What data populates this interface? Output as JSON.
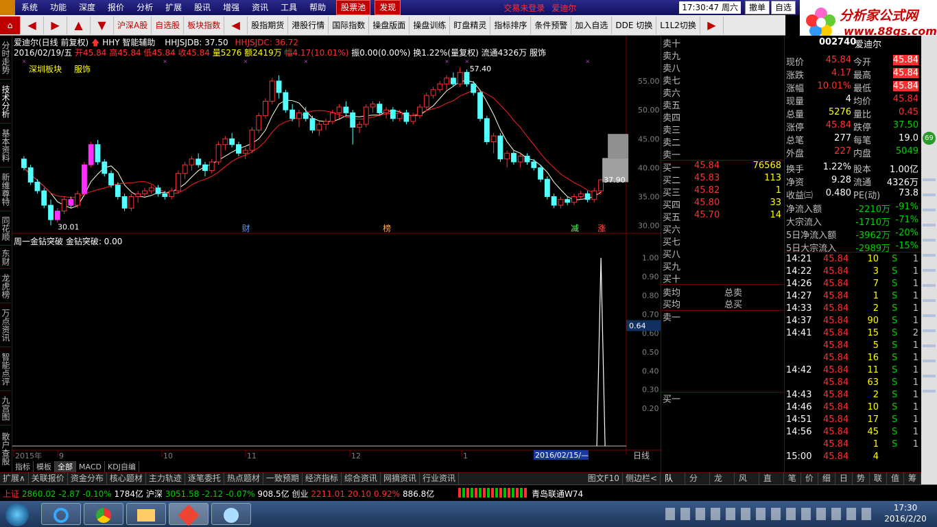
{
  "menu": [
    "系统",
    "功能",
    "深度",
    "报价",
    "分析",
    "扩展",
    "股讯",
    "增强",
    "资讯",
    "工具",
    "帮助"
  ],
  "menu_red": [
    "股票池",
    "发现"
  ],
  "login_status": "交易未登录",
  "stock_name_title": "爱迪尔",
  "clock": "17:30:47 周六",
  "top_buttons": [
    "撤单",
    "自选"
  ],
  "logo_text": "分析家公式网",
  "logo_url": "www.88gs.com",
  "toolbar": [
    "沪深A股",
    "自选股",
    "板块指数",
    "股指期货",
    "港股行情",
    "国际指数",
    "操盘版面",
    "操盘训练",
    "盯盘精灵",
    "指标排序",
    "条件预警",
    "加入自选",
    "DDE 切换",
    "L1L2切换"
  ],
  "left_tabs": [
    "分时走势",
    "技术分析",
    "基本资料",
    "新维尊特",
    "同花顺",
    "东财",
    "龙虎榜",
    "万点资讯",
    "智能点评",
    "九宫图",
    "散户查股"
  ],
  "chart": {
    "title": "爱迪尔(日线 前复权)",
    "indicator": "HHY 智能辅助",
    "hhjsjdb": "HHJSJDB: 37.50",
    "hhjsjdc": "HHJSJDC: 36.72",
    "date_line": "2016/02/19/五",
    "open": "开45.84",
    "high": "高45.84",
    "low": "低45.84",
    "close": "收45.84",
    "volume": "量5276",
    "amount": "额2419万",
    "change": "幅4.17(10.01%)",
    "amp": "振0.00(0.00%)",
    "turnover": "换1.22%(量复权)",
    "float": "流通4326万",
    "sector": "服饰",
    "region": "深圳板块",
    "sector2": "服饰",
    "high_label": "57.40",
    "low_label": "30.01",
    "last_label": "37.90",
    "markers": [
      "财",
      "榜",
      "减",
      "涨"
    ],
    "price_axis": [
      "55.00",
      "50.00",
      "45.00",
      "40.00",
      "35.00",
      "30.00"
    ],
    "sub_title": "周一金钻突破  金钻突破: 0.00",
    "sub_axis": [
      "1.00",
      "0.90",
      "0.80",
      "0.70",
      "0.60",
      "0.50",
      "0.40",
      "0.30",
      "0.20"
    ],
    "sub_current": "0.64",
    "time_axis": [
      "2015年",
      "9",
      "10",
      "11",
      "12",
      "1"
    ],
    "time_current": "2016/02/15/—",
    "period": "日线"
  },
  "chart_data": {
    "type": "candlestick",
    "ohlc": [
      [
        41.5,
        42.0,
        39.5,
        40.0
      ],
      [
        40.0,
        40.5,
        37.0,
        37.5
      ],
      [
        37.5,
        38.0,
        35.5,
        36.0
      ],
      [
        36.0,
        36.5,
        33.0,
        33.5
      ],
      [
        33.5,
        34.5,
        30.01,
        31.0
      ],
      [
        31.0,
        33.0,
        30.5,
        32.5
      ],
      [
        32.5,
        35.0,
        32.0,
        34.5
      ],
      [
        34.5,
        35.0,
        33.0,
        33.5
      ],
      [
        33.5,
        36.0,
        33.0,
        35.5
      ],
      [
        35.5,
        41.0,
        35.0,
        40.5
      ],
      [
        40.5,
        44.5,
        40.0,
        44.0
      ],
      [
        44.0,
        44.8,
        40.5,
        41.0
      ],
      [
        41.0,
        41.5,
        38.5,
        39.0
      ],
      [
        39.0,
        39.5,
        36.5,
        37.0
      ],
      [
        37.0,
        37.5,
        34.5,
        35.0
      ],
      [
        35.0,
        35.5,
        32.5,
        33.0
      ],
      [
        33.0,
        35.5,
        32.5,
        35.0
      ],
      [
        35.0,
        36.0,
        34.0,
        35.5
      ],
      [
        35.5,
        36.5,
        35.0,
        36.0
      ],
      [
        36.0,
        37.0,
        35.5,
        36.5
      ],
      [
        36.5,
        37.0,
        35.0,
        35.5
      ],
      [
        35.5,
        36.0,
        34.5,
        35.0
      ],
      [
        35.0,
        36.5,
        34.5,
        36.0
      ],
      [
        36.0,
        39.5,
        35.5,
        39.0
      ],
      [
        39.0,
        41.0,
        38.0,
        40.5
      ],
      [
        40.5,
        42.0,
        39.5,
        41.5
      ],
      [
        41.5,
        42.5,
        40.0,
        40.5
      ],
      [
        40.5,
        41.0,
        38.5,
        39.5
      ],
      [
        39.5,
        41.5,
        39.0,
        41.0
      ],
      [
        41.0,
        44.5,
        40.5,
        44.0
      ],
      [
        44.0,
        45.5,
        43.0,
        45.0
      ],
      [
        45.0,
        46.0,
        43.5,
        44.0
      ],
      [
        44.0,
        44.5,
        42.0,
        42.5
      ],
      [
        42.5,
        43.5,
        41.5,
        43.0
      ],
      [
        43.0,
        47.0,
        42.5,
        46.5
      ],
      [
        46.5,
        49.5,
        46.0,
        49.0
      ],
      [
        49.0,
        52.0,
        48.5,
        51.5
      ],
      [
        51.5,
        55.5,
        51.0,
        55.0
      ],
      [
        55.0,
        56.0,
        52.0,
        53.0
      ],
      [
        53.0,
        53.5,
        49.5,
        50.0
      ],
      [
        50.0,
        51.0,
        48.0,
        48.5
      ],
      [
        48.5,
        50.0,
        47.0,
        49.5
      ],
      [
        49.5,
        50.5,
        48.0,
        48.5
      ],
      [
        48.5,
        49.0,
        46.0,
        46.5
      ],
      [
        46.5,
        48.0,
        45.5,
        47.5
      ],
      [
        47.5,
        48.5,
        46.5,
        48.0
      ],
      [
        48.0,
        50.0,
        47.5,
        49.5
      ],
      [
        49.5,
        51.0,
        48.5,
        50.5
      ],
      [
        50.5,
        51.5,
        49.0,
        49.5
      ],
      [
        49.5,
        50.0,
        44.0,
        47.0
      ],
      [
        47.0,
        48.0,
        46.0,
        47.5
      ],
      [
        47.5,
        51.0,
        47.0,
        50.5
      ],
      [
        50.5,
        51.5,
        49.5,
        51.0
      ],
      [
        51.0,
        51.5,
        49.0,
        49.5
      ],
      [
        49.5,
        50.5,
        48.5,
        50.0
      ],
      [
        50.0,
        50.5,
        48.0,
        48.5
      ],
      [
        48.5,
        50.0,
        48.0,
        49.5
      ],
      [
        49.5,
        50.0,
        47.5,
        48.0
      ],
      [
        48.0,
        49.5,
        47.5,
        49.0
      ],
      [
        49.0,
        51.0,
        48.5,
        50.5
      ],
      [
        50.5,
        53.0,
        50.0,
        52.5
      ],
      [
        52.5,
        54.0,
        52.0,
        53.5
      ],
      [
        53.5,
        55.0,
        53.0,
        54.5
      ],
      [
        54.5,
        56.0,
        53.5,
        55.5
      ],
      [
        55.5,
        56.5,
        54.0,
        54.5
      ],
      [
        54.5,
        57.4,
        54.0,
        56.5
      ],
      [
        56.5,
        57.0,
        54.0,
        54.5
      ],
      [
        54.5,
        55.0,
        52.5,
        53.0
      ],
      [
        53.0,
        53.5,
        48.0,
        48.5
      ],
      [
        48.5,
        49.0,
        44.0,
        44.5
      ],
      [
        44.5,
        46.0,
        42.5,
        45.5
      ],
      [
        45.5,
        46.0,
        41.0,
        41.5
      ],
      [
        41.5,
        43.0,
        40.0,
        42.5
      ],
      [
        42.5,
        43.0,
        40.5,
        41.0
      ],
      [
        41.0,
        42.5,
        40.0,
        42.0
      ],
      [
        42.0,
        42.5,
        40.5,
        41.0
      ],
      [
        41.0,
        41.5,
        39.5,
        40.0
      ],
      [
        40.0,
        40.5,
        37.5,
        38.0
      ],
      [
        38.0,
        38.5,
        34.5,
        35.0
      ],
      [
        35.0,
        35.5,
        33.0,
        33.5
      ],
      [
        33.5,
        35.0,
        33.0,
        34.5
      ],
      [
        34.5,
        35.0,
        33.5,
        34.0
      ],
      [
        34.0,
        35.5,
        33.5,
        35.0
      ],
      [
        35.0,
        36.0,
        34.5,
        35.5
      ],
      [
        35.5,
        36.0,
        34.0,
        34.5
      ],
      [
        34.5,
        36.5,
        34.0,
        36.0
      ],
      [
        36.0,
        38.0,
        35.5,
        37.9
      ]
    ],
    "limit_up_blocks": [
      [
        41.67,
        45.84
      ]
    ],
    "ylim": [
      29,
      57.5
    ],
    "sub_series": {
      "name": "金钻突破",
      "peak_index": 86,
      "value": 1.0,
      "ylim": [
        0,
        1.05
      ]
    }
  },
  "quote": {
    "code": "002740",
    "name": "爱迪尔",
    "fields": [
      [
        "现价",
        "45.84",
        "今开",
        "45.84"
      ],
      [
        "涨跌",
        "4.17",
        "最高",
        "45.84"
      ],
      [
        "涨幅",
        "10.01%",
        "最低",
        "45.84"
      ],
      [
        "现量",
        "4",
        "均价",
        "45.84"
      ],
      [
        "总量",
        "5276",
        "量比",
        "0.45"
      ],
      [
        "涨停",
        "45.84",
        "跌停",
        "37.50"
      ],
      [
        "总笔",
        "277",
        "每笔",
        "19.0"
      ],
      [
        "外盘",
        "227",
        "内盘",
        "5049"
      ],
      [
        "换手",
        "1.22%",
        "股本",
        "1.00亿"
      ],
      [
        "净资",
        "9.28",
        "流通",
        "4326万"
      ],
      [
        "收益㈢",
        "0.480",
        "PE(动)",
        "73.8"
      ]
    ],
    "flows": [
      [
        "净流入额",
        "-2210万",
        "-91%"
      ],
      [
        "大宗流入",
        "-1710万",
        "-71%"
      ],
      [
        "5日净流入额",
        "-3962万",
        "-20%"
      ],
      [
        "5日大宗流入",
        "-2989万",
        "-15%"
      ]
    ]
  },
  "orderbook": {
    "sell": [
      "卖十",
      "卖九",
      "卖八",
      "卖七",
      "卖六",
      "卖五",
      "卖四",
      "卖三",
      "卖二",
      "卖一"
    ],
    "buy": [
      [
        "买一",
        "45.84",
        "76568"
      ],
      [
        "买二",
        "45.83",
        "113"
      ],
      [
        "买三",
        "45.82",
        "1"
      ],
      [
        "买四",
        "45.80",
        "33"
      ],
      [
        "买五",
        "45.70",
        "14"
      ],
      [
        "买六",
        "",
        ""
      ],
      [
        "买七",
        "",
        ""
      ],
      [
        "买八",
        "",
        ""
      ],
      [
        "买九",
        "",
        ""
      ],
      [
        "买十",
        "",
        ""
      ]
    ],
    "avg": [
      [
        "卖均",
        "总卖"
      ],
      [
        "买均",
        "总买"
      ]
    ],
    "sell1": "卖一",
    "buy1": "买一"
  },
  "ticks": [
    [
      "14:21",
      "45.84",
      "10",
      "S",
      "1"
    ],
    [
      "14:22",
      "45.84",
      "3",
      "S",
      "1"
    ],
    [
      "14:26",
      "45.84",
      "7",
      "S",
      "1"
    ],
    [
      "14:27",
      "45.84",
      "1",
      "S",
      "1"
    ],
    [
      "14:33",
      "45.84",
      "2",
      "S",
      "1"
    ],
    [
      "14:37",
      "45.84",
      "90",
      "S",
      "1"
    ],
    [
      "14:41",
      "45.84",
      "15",
      "S",
      "2"
    ],
    [
      "",
      "45.84",
      "5",
      "S",
      "1"
    ],
    [
      "",
      "45.84",
      "16",
      "S",
      "1"
    ],
    [
      "14:42",
      "45.84",
      "11",
      "S",
      "1"
    ],
    [
      "",
      "45.84",
      "63",
      "S",
      "1"
    ],
    [
      "14:43",
      "45.84",
      "2",
      "S",
      "1"
    ],
    [
      "14:46",
      "45.84",
      "10",
      "S",
      "1"
    ],
    [
      "14:51",
      "45.84",
      "17",
      "S",
      "1"
    ],
    [
      "14:56",
      "45.84",
      "45",
      "S",
      "1"
    ],
    [
      "",
      "45.84",
      "1",
      "S",
      "1"
    ],
    [
      "15:00",
      "45.84",
      "4",
      "",
      ""
    ]
  ],
  "bottom_tabs": [
    "扩展∧",
    "关联报价",
    "资金分布",
    "核心题材",
    "主力轨迹",
    "逐笔委托",
    "热点题材",
    "一致预期",
    "经济指标",
    "综合资讯",
    "网摘资讯",
    "行业资讯"
  ],
  "bottom_tabs_right": [
    "图文F10",
    "侧边栏<"
  ],
  "bottom_tabs_sub": [
    "指标",
    "模板",
    "全部",
    "MACD",
    "KDJ自编"
  ],
  "right_tabs": [
    "队列",
    "分布",
    "龙虎",
    "风向",
    "直播",
    "笔",
    "价",
    "细",
    "日",
    "势",
    "联",
    "值",
    "筹"
  ],
  "status": {
    "sh": "上证",
    "sh_val": "2860.02",
    "sh_chg": "-2.87",
    "sh_pct": "-0.10%",
    "sh_amt": "1784亿",
    "hs": "沪深",
    "hs_val": "3051.58",
    "hs_chg": "-2.12",
    "hs_pct": "-0.07%",
    "hs_amt": "908.5亿",
    "cy": "创业",
    "cy_val": "2211.01",
    "cy_chg": "20.10",
    "cy_pct": "0.92%",
    "cy_amt": "886.8亿",
    "broker": "青岛联通W74"
  },
  "taskbar": {
    "time": "17:30",
    "date": "2016/2/20"
  }
}
